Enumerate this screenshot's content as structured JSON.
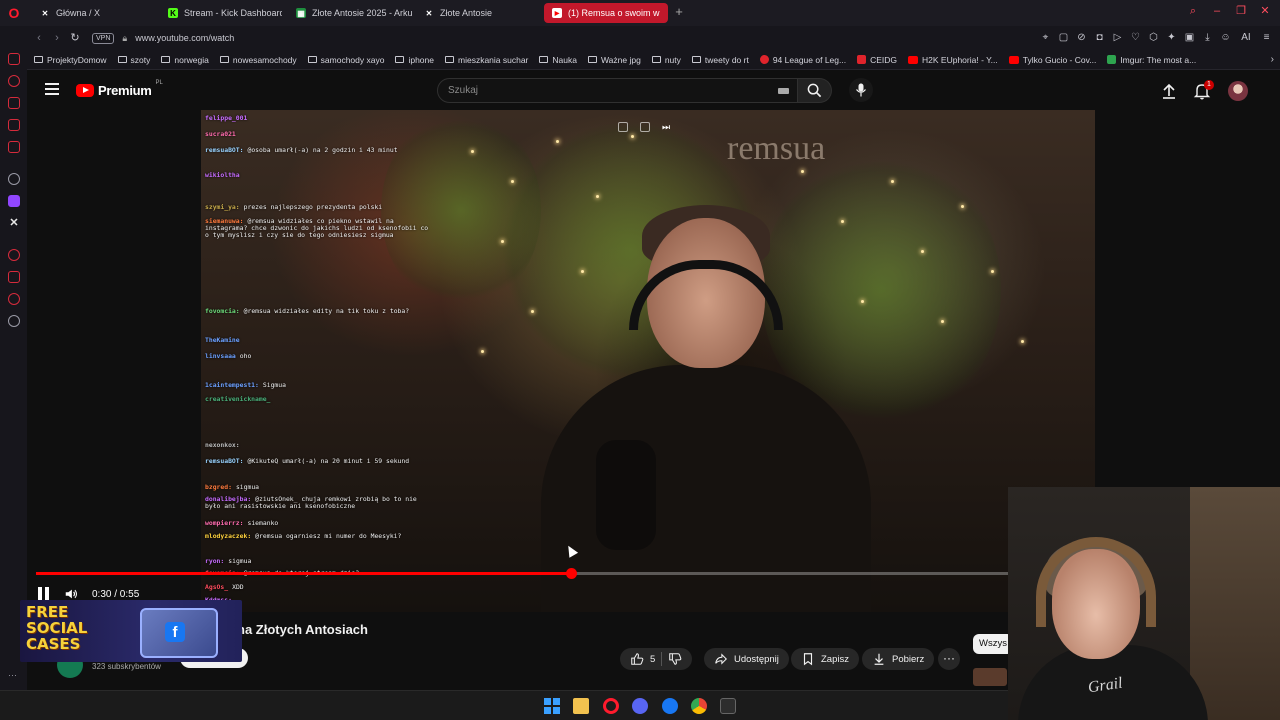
{
  "browser": {
    "tabs": [
      {
        "label": "Główna / X",
        "icon": "x-icon",
        "active": false
      },
      {
        "label": "Stream - Kick Dashboard",
        "icon": "kick-icon",
        "active": false
      },
      {
        "label": "Złote Antosie 2025 - Arku",
        "icon": "sheets-icon",
        "active": false
      },
      {
        "label": "Złote Antosie",
        "icon": "x-icon",
        "active": false
      },
      {
        "label": "(1) Remsua o swoim w",
        "icon": "youtube-icon",
        "active": true
      }
    ],
    "vpn_label": "VPN",
    "url": "www.youtube.com/watch",
    "ai_label": "AI"
  },
  "bookmarks": [
    "ProjektyDomow",
    "szoty",
    "norwegia",
    "nowesamochody",
    "samochody xayo",
    "iphone",
    "mieszkania suchar",
    "Nauka",
    "Ważne jpg",
    "nuty",
    "tweety do rt",
    "94 League of Leg...",
    "CEIDG",
    "H2K EUphoria! - Y...",
    "Tylko Gucio - Cov...",
    "Imgur: The most a..."
  ],
  "youtube": {
    "logo_text": "Premium",
    "region": "PL",
    "search_placeholder": "Szukaj",
    "notification_count": "1"
  },
  "player": {
    "current_time": "0:30",
    "duration": "0:55",
    "time_display": "0:30 / 0:55",
    "progress_fraction": 0.55,
    "watermark": "remsua"
  },
  "chat": [
    {
      "user": "felippe_001",
      "msg": ""
    },
    {
      "user": "sucra021",
      "msg": ""
    },
    {
      "user": "remsuaBOT:",
      "msg": "@osoba umarł(-a) na 2 godzin i 43 minut"
    },
    {
      "user": "wikioltha",
      "msg": ""
    },
    {
      "user": "szymi_ya:",
      "msg": "prezes najlepszego prezydenta polski"
    },
    {
      "user": "siemanuwa:",
      "msg": "@remsua widziałes co piekno wstawil na instagrama? chce dzwonic do jakichs ludzi od ksenofobii co o tym myslisz i czy sie do tego odniesiesz sigmua"
    },
    {
      "user": "fovomcia:",
      "msg": "@remsua widziałes edity na tik toku z toba?"
    },
    {
      "user": "TheKamine",
      "msg": ""
    },
    {
      "user": "linvsaaa",
      "msg": "oho"
    },
    {
      "user": "1caintempest1:",
      "msg": "Sigmua"
    },
    {
      "user": "creativenickname_",
      "msg": ""
    },
    {
      "user": "nexonkox:",
      "msg": ""
    },
    {
      "user": "remsuaBOT:",
      "msg": "@KikuteQ umarł(-a) na 20 minut i 59 sekund"
    },
    {
      "user": "bzgred:",
      "msg": "sigmua"
    },
    {
      "user": "donalibejba:",
      "msg": "@ziutsOnek_ chuja remkowi zrobią bo to nie było ani rasistowskie ani ksenofobiczne"
    },
    {
      "user": "wompierrz:",
      "msg": "siemanko"
    },
    {
      "user": "mlodyzaczek:",
      "msg": "@remsua ogarniesz mi numer do Meesyki?"
    },
    {
      "user": "ryon:",
      "msg": "sigmua"
    },
    {
      "user": "favomcia:",
      "msg": "@remsua do ktorej stream dzis?"
    },
    {
      "user": "AgsOs_",
      "msg": "XDD"
    },
    {
      "user": "Kddmss:",
      "msg": ""
    }
  ],
  "video": {
    "title_visible": "na Złotych Antosiach",
    "subscribers": "323 subskrybentów",
    "likes": "5",
    "share_label": "Udostępnij",
    "save_label": "Zapisz",
    "download_label": "Pobierz",
    "more_label": "···",
    "filter_chip": "Wszys"
  },
  "promo": {
    "line1": "FREE",
    "line2": "SOCIAL",
    "line3": "CASES"
  },
  "webcam": {
    "shirt_text": "Grail"
  },
  "colors": {
    "accent_red": "#ff0000",
    "tab_active": "#c2182b",
    "bg": "#0f0f0f"
  }
}
